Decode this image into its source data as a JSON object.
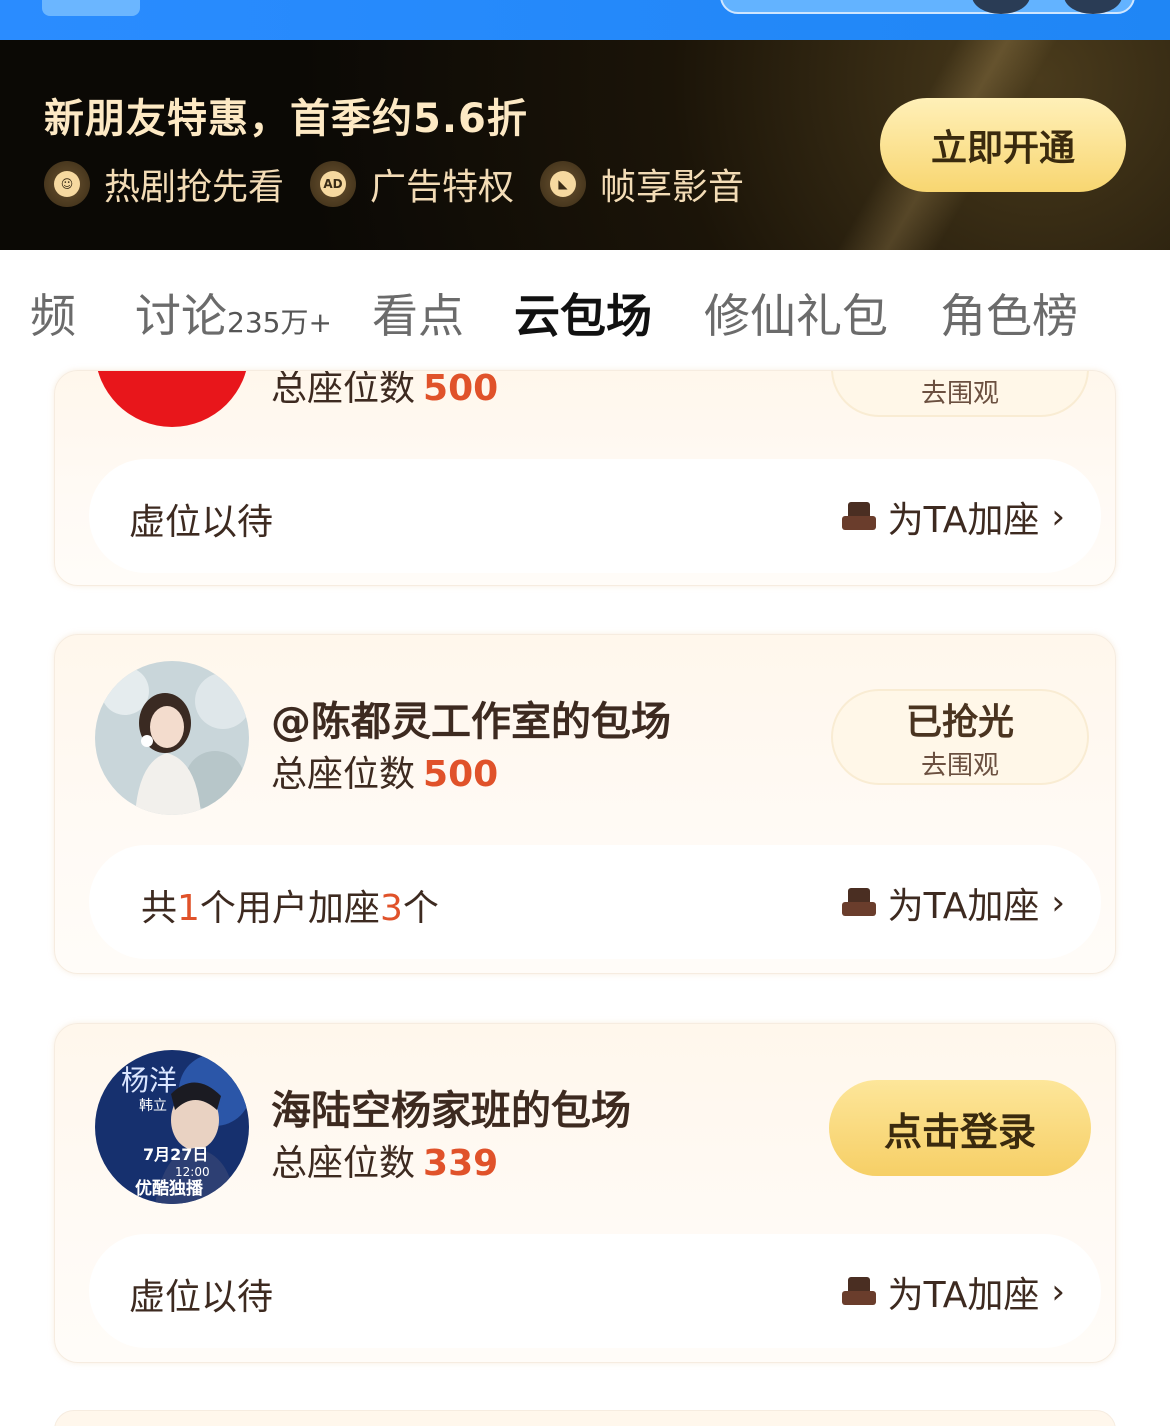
{
  "promo": {
    "title": "新朋友特惠，首季约5.6折",
    "perks": [
      {
        "icon": "smile-icon",
        "label": "热剧抢先看",
        "glyph": "☺"
      },
      {
        "icon": "ad-icon",
        "label": "广告特权",
        "glyph": "AD"
      },
      {
        "icon": "frame-icon",
        "label": "帧享影音",
        "glyph": "◣"
      }
    ],
    "cta": "立即开通"
  },
  "tabs": [
    {
      "label": "频"
    },
    {
      "label": "讨论",
      "badge": "235万+"
    },
    {
      "label": "看点"
    },
    {
      "label": "云包场",
      "active": true
    },
    {
      "label": "修仙礼包"
    },
    {
      "label": "角色榜"
    }
  ],
  "cards": [
    {
      "seats_label": "总座位数",
      "seats": "500",
      "status_sub": "去围观",
      "row_left": "虚位以待",
      "row_action": "为TA加座"
    },
    {
      "title": "@陈都灵工作室的包场",
      "seats_label": "总座位数",
      "seats": "500",
      "status_main": "已抢光",
      "status_sub": "去围观",
      "row_left_parts": [
        "共",
        "1",
        "个用户加座",
        "3",
        "个"
      ],
      "row_action": "为TA加座"
    },
    {
      "title": "海陆空杨家班的包场",
      "seats_label": "总座位数",
      "seats": "339",
      "action": "点击登录",
      "row_left": "虚位以待",
      "row_action": "为TA加座",
      "poster_text": {
        "name": "杨洋",
        "co": "韩立",
        "date": "7月27日",
        "time": "12:00",
        "platform": "优酷独播"
      }
    }
  ],
  "colors": {
    "accent": "#e0522a",
    "gold": "#f8d671",
    "banner_bg": "#0b0905",
    "topbar": "#1f86f5"
  }
}
